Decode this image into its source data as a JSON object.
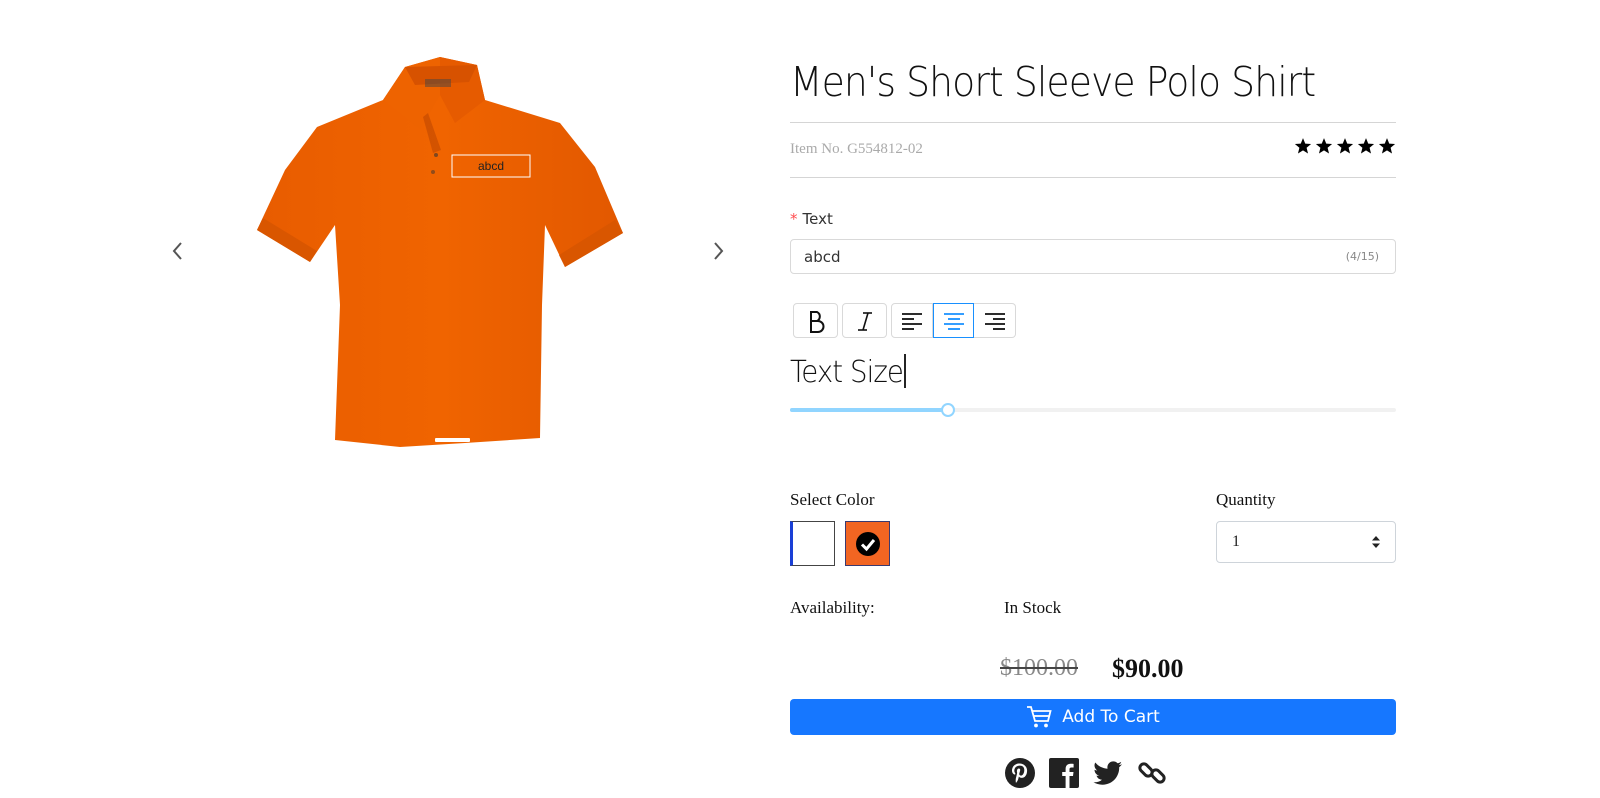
{
  "product": {
    "title": "Men's Short Sleeve Polo Shirt",
    "item_no": "Item No. G554812-02",
    "rating": 5,
    "rating_max": 5,
    "image_text": "abcd",
    "image_color": "#f26522"
  },
  "customize": {
    "text_label": "Text",
    "text_value": "abcd",
    "text_count": "(4/15)",
    "text_size_label": "Text Size",
    "text_size_fraction": 0.26,
    "alignment": "center"
  },
  "color": {
    "label": "Select Color",
    "options": [
      {
        "name": "white",
        "hex": "#ffffff",
        "selected": false
      },
      {
        "name": "orange",
        "hex": "#f26522",
        "selected": true
      }
    ]
  },
  "quantity": {
    "label": "Quantity",
    "value": "1"
  },
  "availability": {
    "label": "Availability:",
    "value": "In Stock"
  },
  "price": {
    "original": "$100.00",
    "sale": "$90.00"
  },
  "cart": {
    "label": "Add To Cart"
  },
  "share": [
    "pinterest-icon",
    "facebook-icon",
    "twitter-icon",
    "link-icon"
  ],
  "colors": {
    "accent": "#1677ff",
    "slider": "#91d5ff",
    "required": "#ff4d4f"
  }
}
